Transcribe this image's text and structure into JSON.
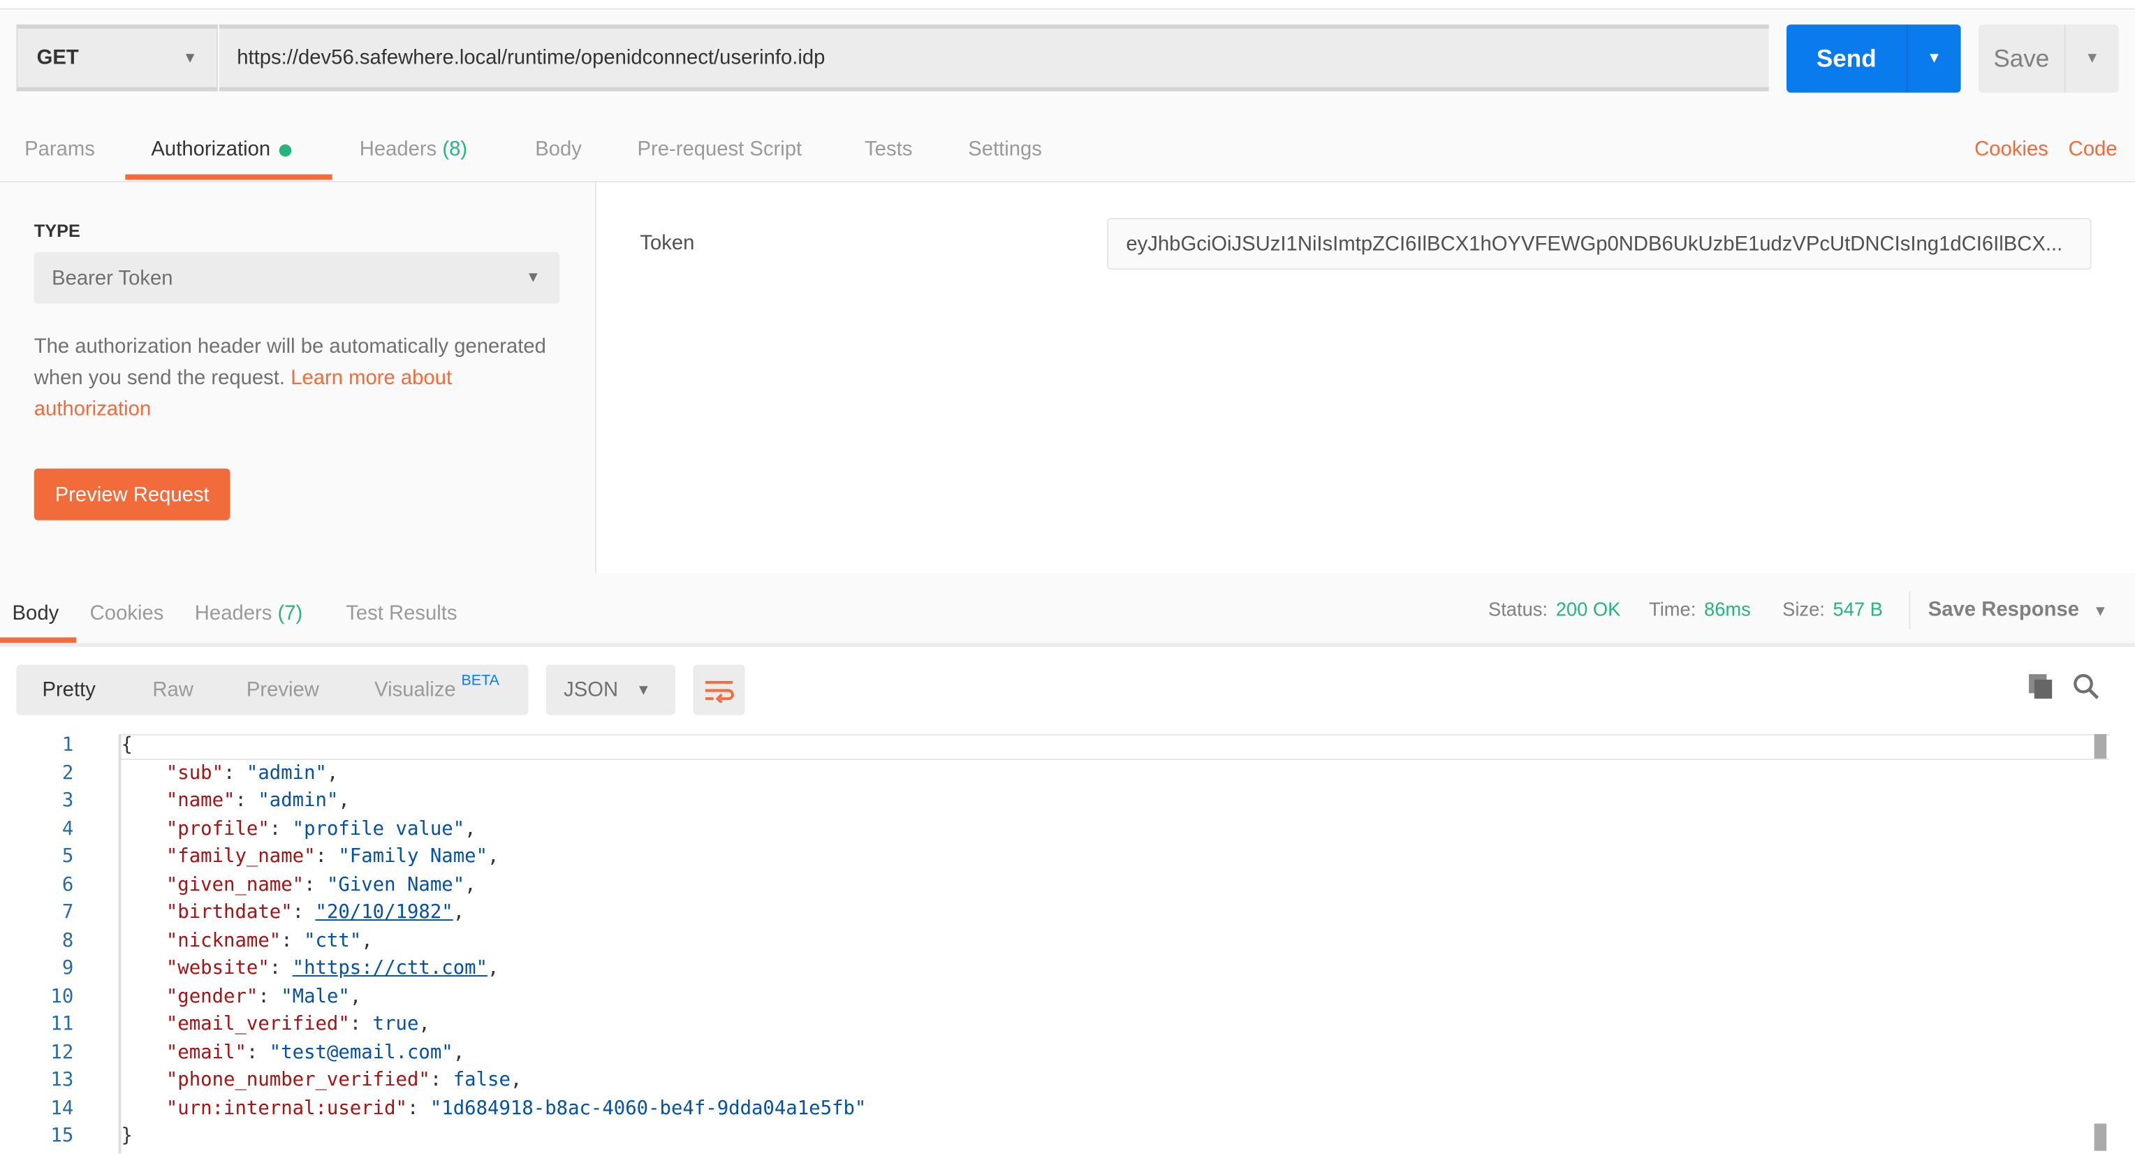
{
  "request": {
    "method": "GET",
    "url": "https://dev56.safewhere.local/runtime/openidconnect/userinfo.idp",
    "send_label": "Send",
    "save_label": "Save"
  },
  "request_tabs": [
    {
      "label": "Params"
    },
    {
      "label": "Authorization"
    },
    {
      "label": "Headers",
      "count": "(8)"
    },
    {
      "label": "Body"
    },
    {
      "label": "Pre-request Script"
    },
    {
      "label": "Tests"
    },
    {
      "label": "Settings"
    }
  ],
  "links": {
    "cookies": "Cookies",
    "code": "Code"
  },
  "auth": {
    "type_label": "TYPE",
    "type_value": "Bearer Token",
    "description": "The authorization header will be automatically generated when you send the request. ",
    "learn_more": "Learn more about authorization",
    "preview_label": "Preview Request",
    "token_label": "Token",
    "token_value": "eyJhbGciOiJSUzI1NiIsImtpZCI6IlBCX1hOYVFEWGp0NDB6UkUzbE1udzVPcUtDNCIsIng1dCI6IlBCX..."
  },
  "response_tabs": [
    {
      "label": "Body"
    },
    {
      "label": "Cookies"
    },
    {
      "label": "Headers",
      "count": "(7)"
    },
    {
      "label": "Test Results"
    }
  ],
  "response_status": {
    "status_label": "Status:",
    "status": "200 OK",
    "time_label": "Time:",
    "time": "86ms",
    "size_label": "Size:",
    "size": "547 B",
    "save_response": "Save Response"
  },
  "view_modes": [
    "Pretty",
    "Raw",
    "Preview",
    "Visualize"
  ],
  "beta_label": "BETA",
  "format": "JSON",
  "colors": {
    "accent": "#f26b3a",
    "primary": "#097bed",
    "success": "#26b47f"
  },
  "code_lines": [
    {
      "n": "1",
      "t": "{"
    },
    {
      "n": "2",
      "k": "\"sub\"",
      "v": "\"admin\"",
      "e": ","
    },
    {
      "n": "3",
      "k": "\"name\"",
      "v": "\"admin\"",
      "e": ","
    },
    {
      "n": "4",
      "k": "\"profile\"",
      "v": "\"profile value\"",
      "e": ","
    },
    {
      "n": "5",
      "k": "\"family_name\"",
      "v": "\"Family Name\"",
      "e": ","
    },
    {
      "n": "6",
      "k": "\"given_name\"",
      "v": "\"Given Name\"",
      "e": ","
    },
    {
      "n": "7",
      "k": "\"birthdate\"",
      "v": "\"20/10/1982\"",
      "e": ","
    },
    {
      "n": "8",
      "k": "\"nickname\"",
      "v": "\"ctt\"",
      "e": ","
    },
    {
      "n": "9",
      "k": "\"website\"",
      "v": "\"https://ctt.com\"",
      "e": ","
    },
    {
      "n": "10",
      "k": "\"gender\"",
      "v": "\"Male\"",
      "e": ","
    },
    {
      "n": "11",
      "k": "\"email_verified\"",
      "v": "true",
      "e": ","
    },
    {
      "n": "12",
      "k": "\"email\"",
      "v": "\"test@email.com\"",
      "e": ","
    },
    {
      "n": "13",
      "k": "\"phone_number_verified\"",
      "v": "false",
      "e": ","
    },
    {
      "n": "14",
      "k": "\"urn:internal:userid\"",
      "v": "\"1d684918-b8ac-4060-be4f-9dda04a1e5fb\"",
      "e": ""
    },
    {
      "n": "15",
      "t": "}"
    }
  ]
}
